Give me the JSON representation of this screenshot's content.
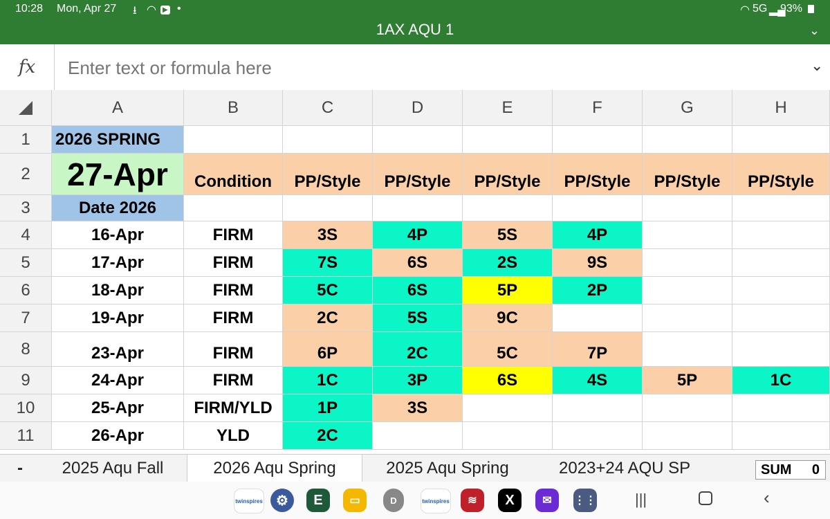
{
  "status": {
    "time": "10:28",
    "date": "Mon, Apr 27",
    "network": "5G",
    "battery": "93%"
  },
  "title": "1AX AQU 1",
  "formula": {
    "fx_label": "fx",
    "placeholder": "Enter text or formula here"
  },
  "columns": [
    "A",
    "B",
    "C",
    "D",
    "E",
    "F",
    "G",
    "H"
  ],
  "rows": [
    "1",
    "2",
    "3",
    "4",
    "5",
    "6",
    "7",
    "8",
    "9",
    "10",
    "11"
  ],
  "cells": {
    "a1": "2026 SPRING",
    "a2": "27-Apr",
    "a3": "Date 2026",
    "b2": "Condition",
    "c2": "PP/Style",
    "d2": "PP/Style",
    "e2": "PP/Style",
    "f2": "PP/Style",
    "g2": "PP/Style",
    "h2": "PP/Style",
    "a4": "16-Apr",
    "b4": "FIRM",
    "c4": "3S",
    "d4": "4P",
    "e4": "5S",
    "f4": "4P",
    "a5": "17-Apr",
    "b5": "FIRM",
    "c5": "7S",
    "d5": "6S",
    "e5": "2S",
    "f5": "9S",
    "a6": "18-Apr",
    "b6": "FIRM",
    "c6": "5C",
    "d6": "6S",
    "e6": "5P",
    "f6": "2P",
    "a7": "19-Apr",
    "b7": "FIRM",
    "c7": "2C",
    "d7": "5S",
    "e7": "9C",
    "a8": "23-Apr",
    "b8": "FIRM",
    "c8": "6P",
    "d8": "2C",
    "e8": "5C",
    "f8": "7P",
    "a9": "24-Apr",
    "b9": "FIRM",
    "c9": "1C",
    "d9": "3P",
    "e9": "6S",
    "f9": "4S",
    "g9": "5P",
    "h9": "1C",
    "a10": "25-Apr",
    "b10": "FIRM/YLD",
    "c10": "1P",
    "d10": "3S",
    "a11": "26-Apr",
    "b11": "YLD",
    "c11": "2C"
  },
  "sheet_tabs": {
    "menu": "-",
    "items": [
      "2025 Aqu Fall",
      "2026 Aqu Spring",
      "2025 Aqu Spring",
      "2023+24 AQU SP"
    ],
    "active": "2026 Aqu Spring"
  },
  "sum": {
    "label": "SUM",
    "value": "0"
  },
  "dock_apps": [
    "twinspires",
    "settings-icon",
    "E",
    "files-icon",
    "D",
    "twinspires",
    "red-app-icon",
    "X",
    "mail-icon",
    "apps-grid-icon"
  ],
  "colors": {
    "title_bar": "#2e7d32",
    "peach": "#fbd0a8",
    "teal": "#0cf5c6",
    "yellow": "#ffff00",
    "blue": "#a0c4e8",
    "green": "#c8f7c5"
  }
}
